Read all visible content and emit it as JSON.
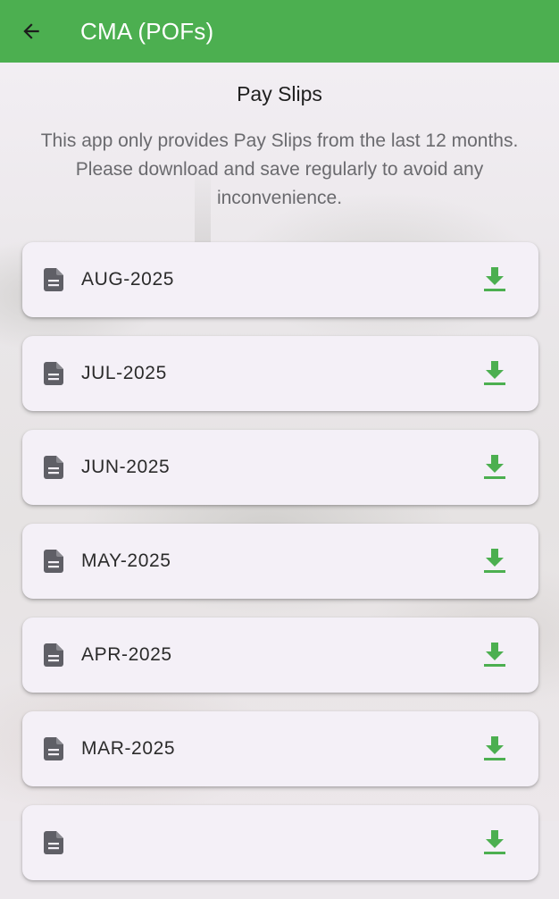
{
  "appbar": {
    "title": "CMA (POFs)",
    "back_icon": "arrow-back-icon",
    "color": "#4caf50"
  },
  "page": {
    "title": "Pay Slips",
    "notice": "This app only provides Pay Slips from the last 12 months. Please download and save regularly to avoid any inconvenience."
  },
  "slips": [
    {
      "label": "AUG-2025"
    },
    {
      "label": "JUL-2025"
    },
    {
      "label": "JUN-2025"
    },
    {
      "label": "MAY-2025"
    },
    {
      "label": "APR-2025"
    },
    {
      "label": "MAR-2025"
    },
    {
      "label": ""
    }
  ],
  "icons": {
    "slip": "document-icon",
    "download": "download-icon"
  },
  "colors": {
    "accent": "#4caf50",
    "card": "#f4f0f7",
    "icon_grey": "#5f5f66"
  }
}
